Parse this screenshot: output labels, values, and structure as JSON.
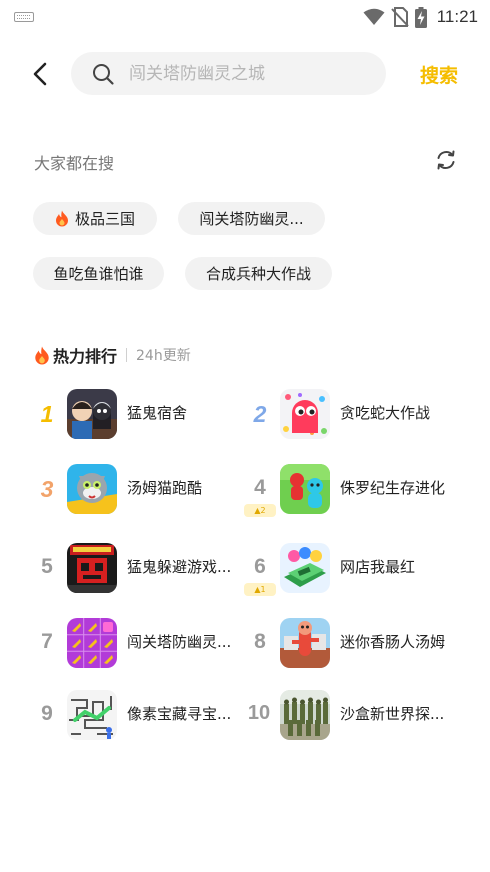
{
  "status_bar": {
    "time": "11:21",
    "icons": [
      "keyboard-icon",
      "wifi-icon",
      "no-sim-icon",
      "battery-charging-icon"
    ]
  },
  "search": {
    "placeholder": "闯关塔防幽灵之城",
    "submit_label": "搜索"
  },
  "hot_searches": {
    "title": "大家都在搜",
    "items": [
      {
        "label": "极品三国",
        "icon": "flame-icon"
      },
      {
        "label": "闯关塔防幽灵..."
      },
      {
        "label": "鱼吃鱼谁怕谁"
      },
      {
        "label": "合成兵种大作战"
      }
    ]
  },
  "ranking": {
    "title": "热力排行",
    "subtitle": "24h更新",
    "accent_color": "#f5bd00",
    "items": [
      {
        "rank": "1",
        "name": "猛鬼宿舍"
      },
      {
        "rank": "2",
        "name": "贪吃蛇大作战"
      },
      {
        "rank": "3",
        "name": "汤姆猫跑酷"
      },
      {
        "rank": "4",
        "name": "侏罗纪生存进化",
        "change": "2"
      },
      {
        "rank": "5",
        "name": "猛鬼躲避游戏..."
      },
      {
        "rank": "6",
        "name": "网店我最红",
        "change": "1"
      },
      {
        "rank": "7",
        "name": "闯关塔防幽灵..."
      },
      {
        "rank": "8",
        "name": "迷你香肠人汤姆"
      },
      {
        "rank": "9",
        "name": "像素宝藏寻宝..."
      },
      {
        "rank": "10",
        "name": "沙盒新世界探..."
      }
    ]
  }
}
